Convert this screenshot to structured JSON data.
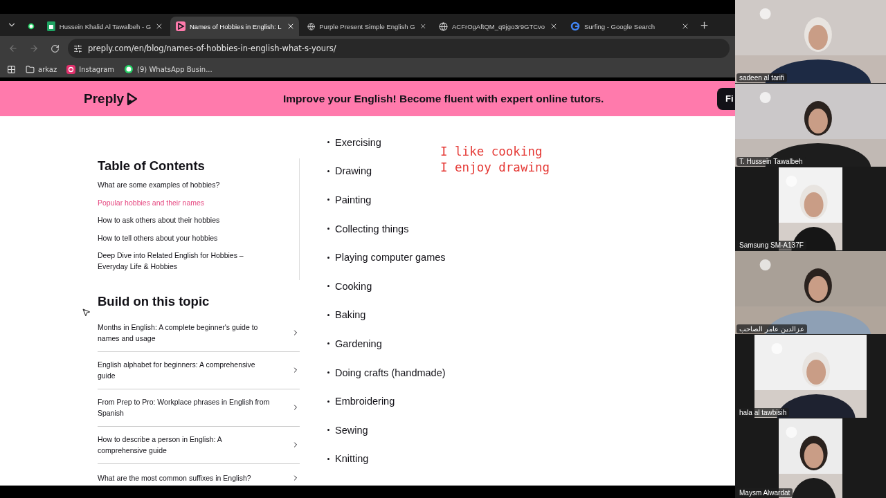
{
  "tabs": [
    {
      "selected": false
    },
    {
      "title": "Hussein Khalid Al Tawalbeh - G",
      "selected": false
    },
    {
      "title": "Names of Hobbies in English: L",
      "selected": true
    },
    {
      "title": "Purple Present Simple English G",
      "selected": false
    },
    {
      "title": "ACFrOgAftQM_q9jgo3r9GTCvo",
      "selected": false
    },
    {
      "title": "Surfing - Google Search",
      "selected": false
    }
  ],
  "url": "preply.com/en/blog/names-of-hobbies-in-english-what-s-yours/",
  "bookmarks": [
    {
      "label": "arkaz"
    },
    {
      "label": "Instagram"
    },
    {
      "label": "(9) WhatsApp Busin..."
    }
  ],
  "banner": {
    "logo": "Preply",
    "message": "Improve your English! Become fluent with expert online tutors.",
    "button": "Fi"
  },
  "toc": {
    "title": "Table of Contents",
    "items": [
      {
        "label": "What are some examples of hobbies?",
        "selected": false
      },
      {
        "label": "Popular hobbies and their names",
        "selected": true
      },
      {
        "label": "How to ask others about their hobbies",
        "selected": false
      },
      {
        "label": "How to tell others about your hobbies",
        "selected": false
      },
      {
        "label": "Deep Dive into Related English for Hobbies – Everyday Life & Hobbies",
        "selected": false
      }
    ]
  },
  "related": {
    "title": "Build on this topic",
    "items": [
      "Months in English: A complete beginner's guide to names and usage",
      "English alphabet for beginners: A comprehensive guide",
      "From Prep to Pro: Workplace phrases in English from Spanish",
      "How to describe a person in English: A comprehensive guide",
      "What are the most common suffixes in English?"
    ]
  },
  "hobbies": [
    "Exercising",
    "Drawing",
    "Painting",
    "Collecting things",
    "Playing computer games",
    "Cooking",
    "Baking",
    "Gardening",
    "Doing crafts (handmade)",
    "Embroidering",
    "Sewing",
    "Knitting"
  ],
  "annotation": [
    "I like cooking",
    "I enjoy drawing"
  ],
  "participants": [
    {
      "name": "sadeen al tarifi",
      "kind": "picture"
    },
    {
      "name": "T. Hussein Tawalbeh",
      "kind": "picture"
    },
    {
      "name": "Samsung SM-A137F",
      "kind": "picture"
    },
    {
      "name": "عزالدين عامر الصاحب",
      "kind": "picture"
    },
    {
      "name": "hala al tawbisih",
      "kind": "picture"
    },
    {
      "name": "Maysm Alwardat",
      "kind": "picture"
    }
  ]
}
